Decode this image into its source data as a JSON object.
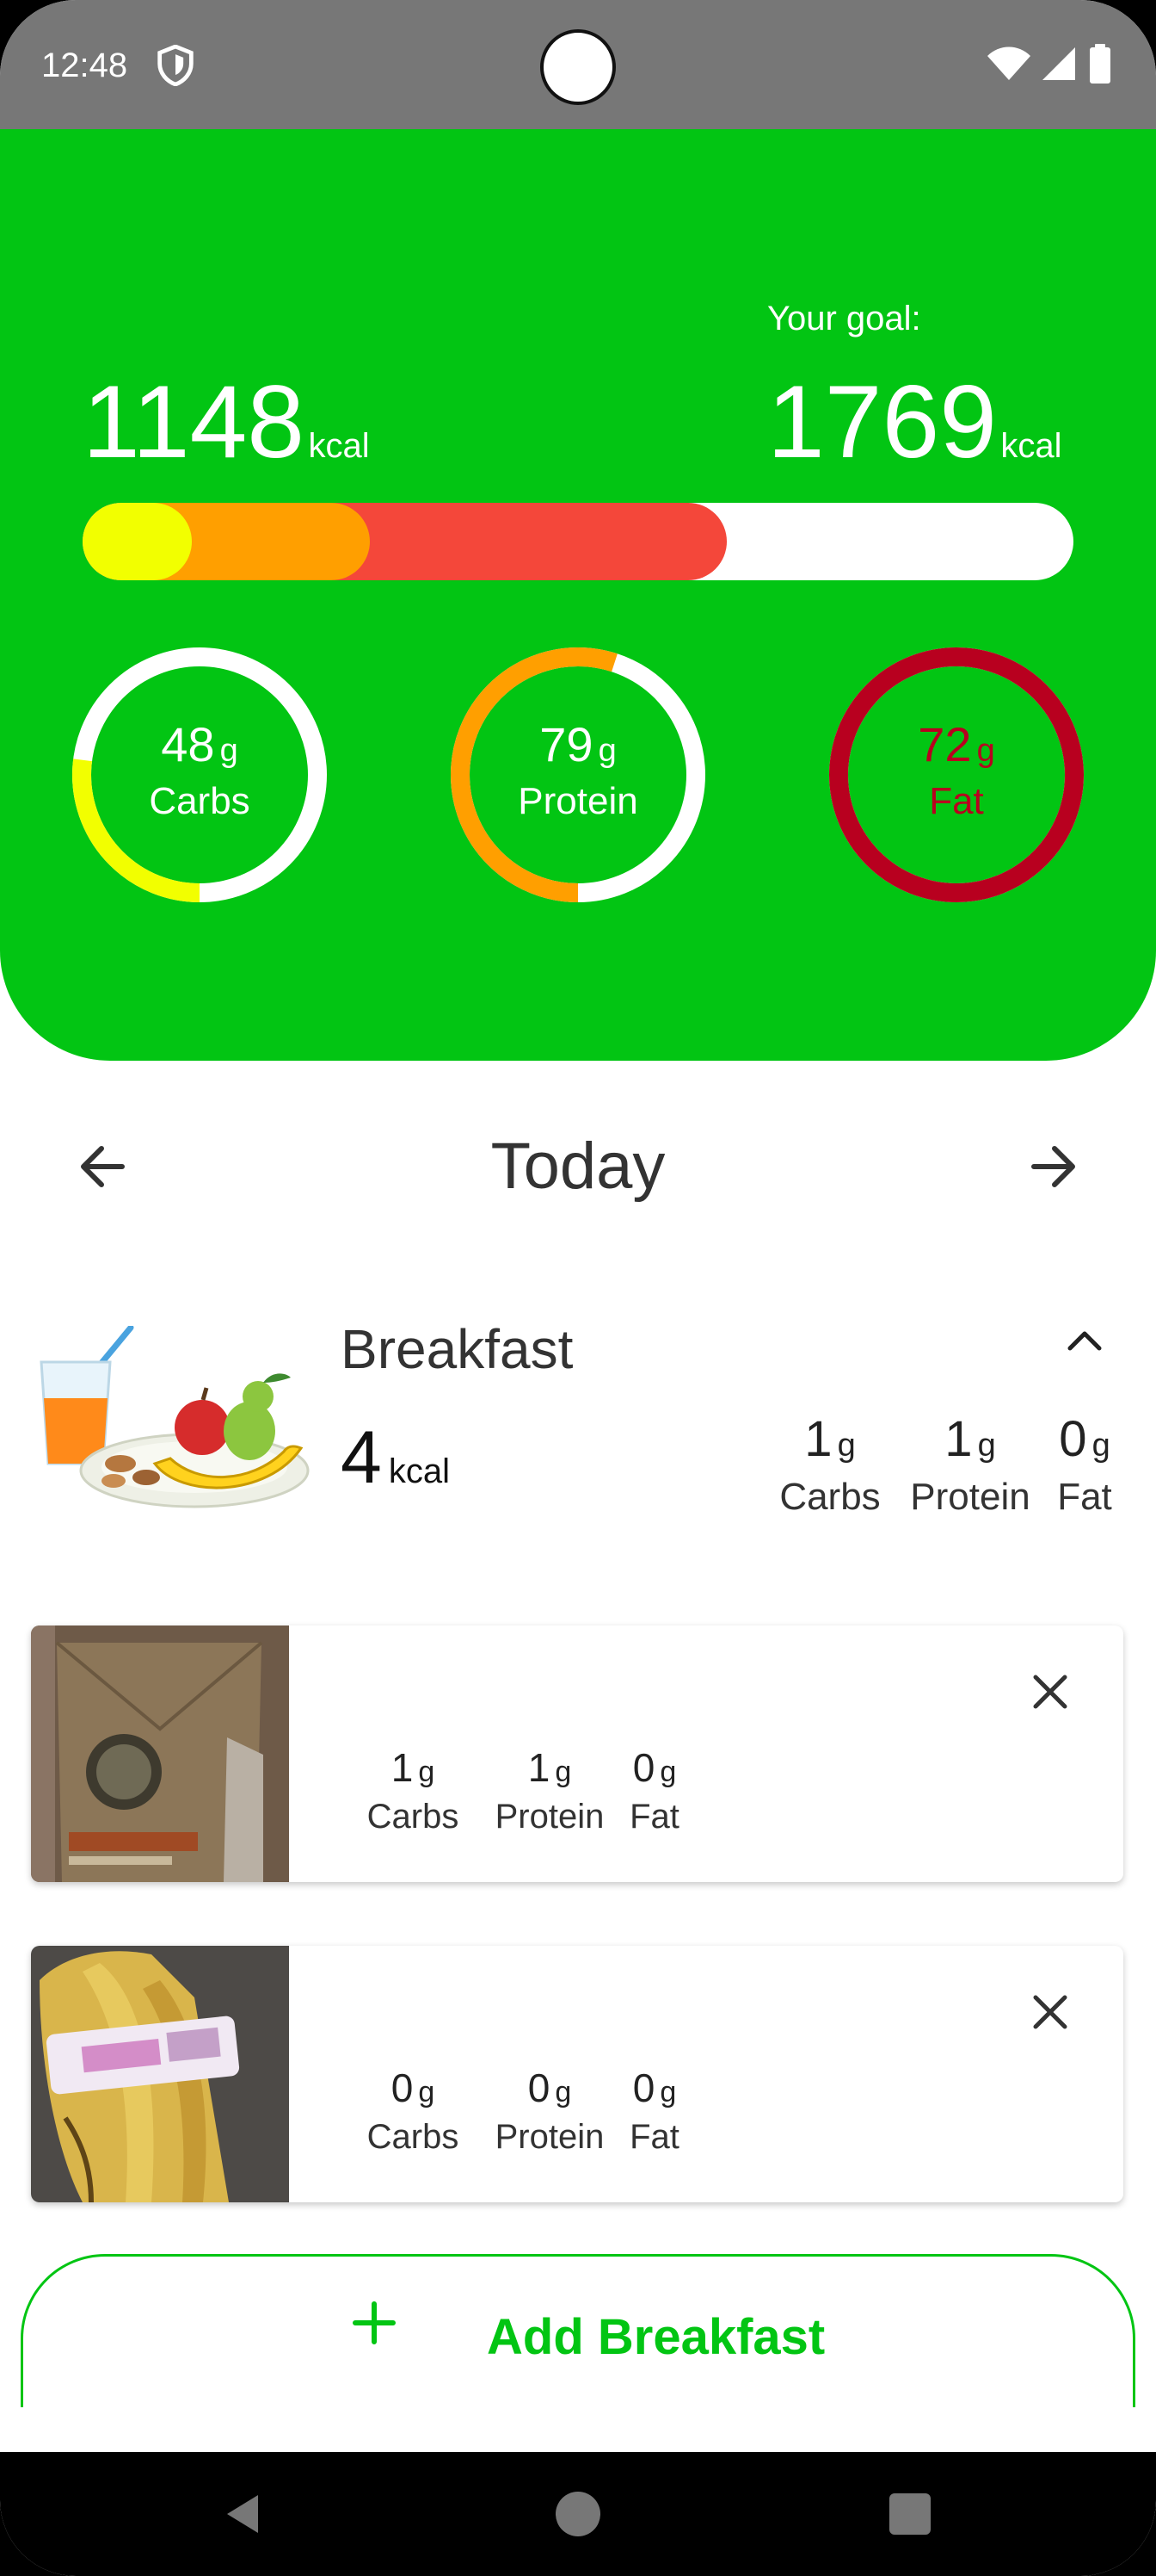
{
  "status_bar": {
    "time": "12:48",
    "icons": [
      "shield-icon",
      "wifi-icon",
      "signal-icon",
      "battery-icon"
    ]
  },
  "summary": {
    "consumed_value": "1148",
    "consumed_unit": "kcal",
    "goal_label": "Your goal:",
    "goal_value": "1769",
    "goal_unit": "kcal",
    "progress_fractions": {
      "carbs": 0.11,
      "protein": 0.29,
      "fat": 0.65
    },
    "colors": {
      "header": "#02c513",
      "carbs": "#f2ff00",
      "protein": "#ff9f00",
      "fat_bar": "#f4473a",
      "fat_ring": "#b8001f"
    }
  },
  "macros": [
    {
      "value": "48",
      "unit": "g",
      "label": "Carbs",
      "fill_fraction": 0.27
    },
    {
      "value": "79",
      "unit": "g",
      "label": "Protein",
      "fill_fraction": 0.55
    },
    {
      "value": "72",
      "unit": "g",
      "label": "Fat",
      "fill_fraction": 1.0
    }
  ],
  "date_nav": {
    "title": "Today",
    "prev_icon": "arrow-left-icon",
    "next_icon": "arrow-right-icon"
  },
  "meal": {
    "title": "Breakfast",
    "kcal_value": "4",
    "kcal_unit": "kcal",
    "collapse_icon": "chevron-up-icon",
    "macros": [
      {
        "value": "1",
        "unit": "g",
        "label": "Carbs"
      },
      {
        "value": "1",
        "unit": "g",
        "label": "Protein"
      },
      {
        "value": "0",
        "unit": "g",
        "label": "Fat"
      }
    ]
  },
  "food_items": [
    {
      "photo": "coffee-bag-photo",
      "macros": [
        {
          "value": "1",
          "unit": "g",
          "label": "Carbs"
        },
        {
          "value": "1",
          "unit": "g",
          "label": "Protein"
        },
        {
          "value": "0",
          "unit": "g",
          "label": "Fat"
        }
      ]
    },
    {
      "photo": "bananas-photo",
      "macros": [
        {
          "value": "0",
          "unit": "g",
          "label": "Carbs"
        },
        {
          "value": "0",
          "unit": "g",
          "label": "Protein"
        },
        {
          "value": "0",
          "unit": "g",
          "label": "Fat"
        }
      ]
    }
  ],
  "add_button": {
    "icon": "plus-icon",
    "label": "Add Breakfast"
  },
  "nav_bar": {
    "icons": [
      "back-icon",
      "home-icon",
      "recents-icon"
    ]
  }
}
